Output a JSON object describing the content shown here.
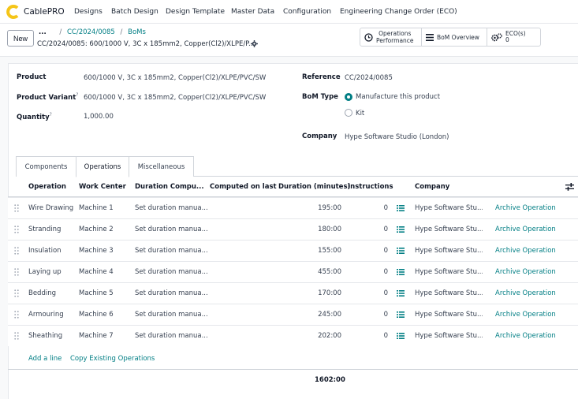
{
  "app": {
    "name": "CablePRO",
    "logo_color": "#f5c518"
  },
  "menu": [
    "Designs",
    "Batch Design",
    "Design Template",
    "Master Data",
    "Configuration",
    "Engineering Change Order (ECO)"
  ],
  "control": {
    "new_label": "New",
    "breadcrumb_dots": "...",
    "breadcrumb": [
      "CC/2024/0085",
      "BoMs"
    ],
    "record_title": "CC/2024/0085: 600/1000 V, 3C x 185mm2, Copper(Cl2)/XLPE/P..."
  },
  "smart_buttons": {
    "operations_line1": "Operations",
    "operations_line2": "Performance",
    "bom_overview": "BoM Overview",
    "eco_line1": "ECO(s)",
    "eco_line2": "0"
  },
  "form": {
    "product_label": "Product",
    "product_value": "600/1000 V, 3C x 185mm2, Copper(Cl2)/XLPE/PVC/SW",
    "variant_label": "Product Variant",
    "variant_value": "600/1000 V, 3C x 185mm2, Copper(Cl2)/XLPE/PVC/SW",
    "quantity_label": "Quantity",
    "quantity_value": "1,000.00",
    "help_mark": "?",
    "reference_label": "Reference",
    "reference_value": "CC/2024/0085",
    "bom_type_label": "BoM Type",
    "bom_type_option1": "Manufacture this product",
    "bom_type_option2": "Kit",
    "company_label": "Company",
    "company_value": "Hype Software Studio (London)"
  },
  "tabs": [
    "Components",
    "Operations",
    "Miscellaneous"
  ],
  "table": {
    "headers": [
      "Operation",
      "Work Center",
      "Duration Compu...",
      "Computed on last",
      "Duration (minutes)",
      "Instructions",
      "Company"
    ],
    "rows": [
      {
        "operation": "Wire Drawing",
        "work_center": "Machine 1",
        "computation": "Set duration manua...",
        "duration": "195:00",
        "instructions": "0",
        "company": "Hype Software Stu...",
        "action": "Archive Operation"
      },
      {
        "operation": "Stranding",
        "work_center": "Machine 2",
        "computation": "Set duration manua...",
        "duration": "180:00",
        "instructions": "0",
        "company": "Hype Software Stu...",
        "action": "Archive Operation"
      },
      {
        "operation": "Insulation",
        "work_center": "Machine 3",
        "computation": "Set duration manua...",
        "duration": "155:00",
        "instructions": "0",
        "company": "Hype Software Stu...",
        "action": "Archive Operation"
      },
      {
        "operation": "Laying up",
        "work_center": "Machine 4",
        "computation": "Set duration manua...",
        "duration": "455:00",
        "instructions": "0",
        "company": "Hype Software Stu...",
        "action": "Archive Operation"
      },
      {
        "operation": "Bedding",
        "work_center": "Machine 5",
        "computation": "Set duration manua...",
        "duration": "170:00",
        "instructions": "0",
        "company": "Hype Software Stu...",
        "action": "Archive Operation"
      },
      {
        "operation": "Armouring",
        "work_center": "Machine 6",
        "computation": "Set duration manua...",
        "duration": "245:00",
        "instructions": "0",
        "company": "Hype Software Stu...",
        "action": "Archive Operation"
      },
      {
        "operation": "Sheathing",
        "work_center": "Machine 7",
        "computation": "Set duration manua...",
        "duration": "202:00",
        "instructions": "0",
        "company": "Hype Software Stu...",
        "action": "Archive Operation"
      }
    ],
    "add_line": "Add a line",
    "copy_existing": "Copy Existing Operations",
    "total_duration": "1602:00"
  },
  "colors": {
    "accent": "#017e84"
  }
}
